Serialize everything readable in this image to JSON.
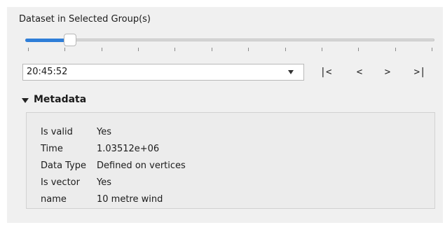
{
  "group": {
    "title": "Dataset in Selected Group(s)"
  },
  "slider": {
    "position_fraction": 0.11,
    "tick_count": 12,
    "colors": {
      "fill": "#2f7ed8",
      "track": "#d8d8d8"
    }
  },
  "time_combo": {
    "value": "20:45:52",
    "icon": "chevron-down-icon"
  },
  "nav": {
    "first": "|<",
    "previous": "<",
    "next": ">",
    "last": ">|"
  },
  "metadata": {
    "title": "Metadata",
    "expanded": true,
    "rows": [
      {
        "key": "Is valid",
        "value": "Yes"
      },
      {
        "key": "Time",
        "value": "1.03512e+06"
      },
      {
        "key": "Data Type",
        "value": "Defined on vertices"
      },
      {
        "key": "Is vector",
        "value": "Yes"
      },
      {
        "key": "name",
        "value": "10 metre wind"
      }
    ]
  }
}
